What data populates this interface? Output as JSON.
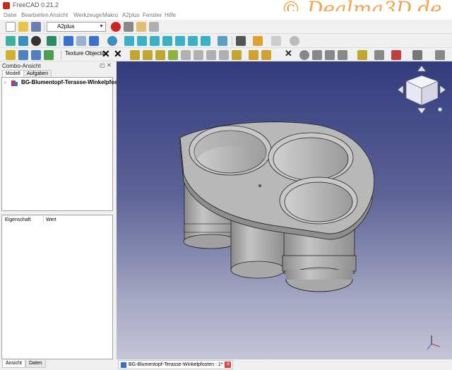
{
  "window": {
    "title": "FreeCAD 0.21.2",
    "watermark": "© Dealma3D.de"
  },
  "menu": {
    "items": [
      "Datei",
      "Bearbeiten",
      "Ansicht",
      "Werkzeuge",
      "Makro",
      "A2plus",
      "Fenster",
      "Hilfe"
    ]
  },
  "toolbar": {
    "workbench": "A2plus",
    "texture_objects": "Texture Objects"
  },
  "combo_view": {
    "title": "Combo-Ansicht",
    "tabs": [
      "Modell",
      "Aufgaben"
    ],
    "tree_item": "BG-Blumentopf-Terasse-Winkelpfosten",
    "property_headers": [
      "Eigenschaft",
      "Wert"
    ],
    "bottom_tabs": [
      "Ansicht",
      "Daten"
    ]
  },
  "document": {
    "tab_label": "BG-Blumentopf-Terasse-Winkelpfosten : 1*"
  },
  "colors": {
    "viewport_top": "#323c7e",
    "viewport_bottom": "#c5c5d8",
    "model_grey": "#b8b8b8",
    "watermark": "#f4a24e"
  },
  "icons": {
    "nav_cube": "navigation-cube-icon",
    "axis": "axis-cross-icon"
  }
}
